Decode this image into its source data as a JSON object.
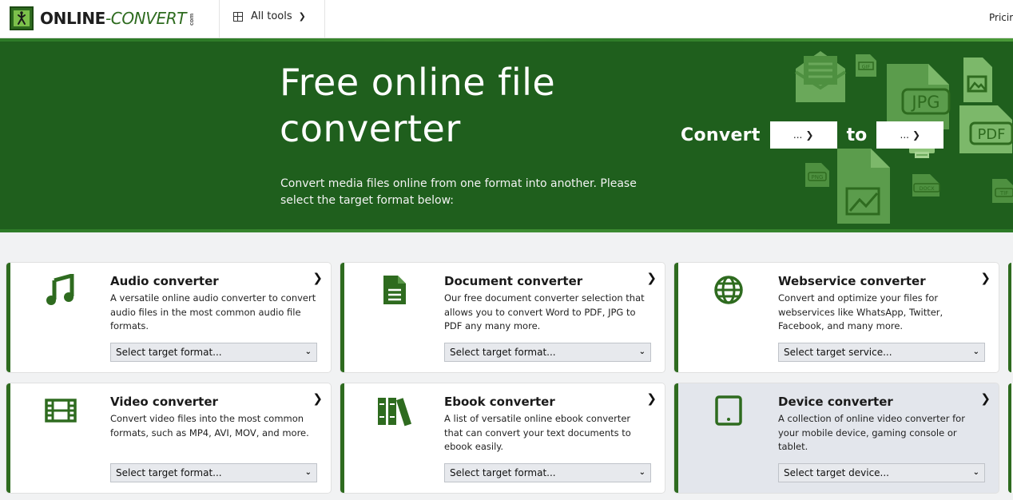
{
  "header": {
    "logo_main": "ONLINE",
    "logo_dash": "-",
    "logo_accent": "CONVERT",
    "logo_com": "com",
    "all_tools": "All tools",
    "pricing": "Pricir"
  },
  "hero": {
    "title": "Free online file converter",
    "subtitle": "Convert media files online from one format into another. Please select the target format below:",
    "convert_label": "Convert",
    "from_value": "...",
    "to_label": "to",
    "to_value": "...",
    "deco_labels": [
      "GIF",
      "JPG",
      "PDF",
      "PNG",
      "DOCX",
      "TIF"
    ]
  },
  "cards": [
    {
      "title": "Audio converter",
      "desc": "A versatile online audio converter to convert audio files in the most common audio file formats.",
      "select": "Select target format...",
      "icon": "music-note-icon"
    },
    {
      "title": "Document converter",
      "desc": "Our free document converter selection that allows you to convert Word to PDF, JPG to PDF any many more.",
      "select": "Select target format...",
      "icon": "document-icon"
    },
    {
      "title": "Webservice converter",
      "desc": "Convert and optimize your files for webservices like WhatsApp, Twitter, Facebook, and many more.",
      "select": "Select target service...",
      "icon": "globe-icon"
    },
    {
      "title": "Video converter",
      "desc": "Convert video files into the most common formats, such as MP4, AVI, MOV, and more.",
      "select": "Select target format...",
      "icon": "film-icon"
    },
    {
      "title": "Ebook converter",
      "desc": "A list of versatile online ebook converter that can convert your text documents to ebook easily.",
      "select": "Select target format...",
      "icon": "books-icon"
    },
    {
      "title": "Device converter",
      "desc": "A collection of online video converter for your mobile device, gaming console or tablet.",
      "select": "Select target device...",
      "icon": "tablet-icon"
    }
  ],
  "colors": {
    "brand_green": "#2e6b1f",
    "hero_bg": "#1f5f1d",
    "active_card": "#e3e6ec"
  }
}
